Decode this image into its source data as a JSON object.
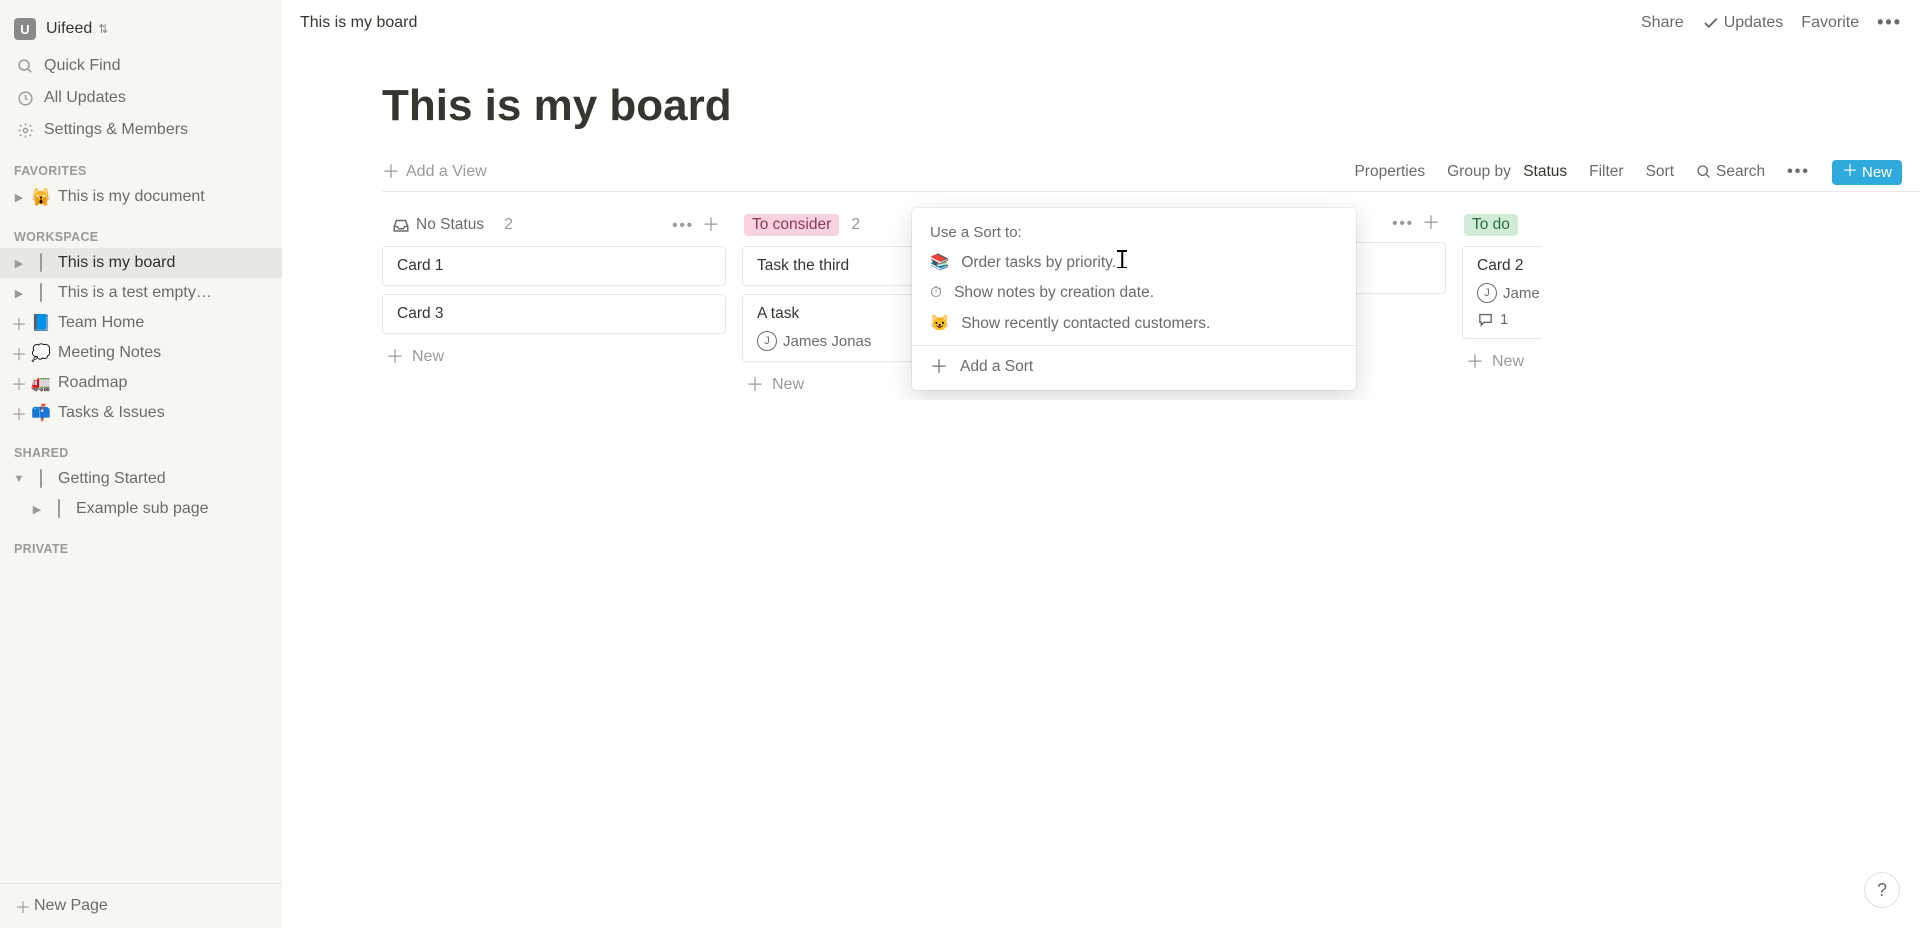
{
  "workspace": {
    "initial": "U",
    "name": "Uifeed"
  },
  "sidebar": {
    "quick_find": "Quick Find",
    "all_updates": "All Updates",
    "settings": "Settings & Members",
    "sections": {
      "favorites": "FAVORITES",
      "workspace": "WORKSPACE",
      "shared": "SHARED",
      "private": "PRIVATE"
    },
    "favorites": [
      {
        "icon": "🙀",
        "label": "This is my document"
      }
    ],
    "workspace_pages": [
      {
        "icon": "page",
        "label": "This is my board",
        "active": true,
        "toggle": "▶"
      },
      {
        "icon": "page",
        "label": "This is a test empty…",
        "toggle": "▶"
      },
      {
        "icon": "📘",
        "label": "Team Home",
        "plus": true
      },
      {
        "icon": "💭",
        "label": "Meeting Notes",
        "plus": true
      },
      {
        "icon": "🚛",
        "label": "Roadmap",
        "plus": true
      },
      {
        "icon": "📫",
        "label": "Tasks & Issues",
        "plus": true
      }
    ],
    "shared_pages": [
      {
        "icon": "page",
        "label": "Getting Started",
        "toggle": "▼"
      },
      {
        "icon": "page",
        "label": "Example sub page",
        "nested": true,
        "toggle": "▶"
      }
    ],
    "new_page": "New Page"
  },
  "topbar": {
    "breadcrumb": "This is my board",
    "share": "Share",
    "updates": "Updates",
    "favorite": "Favorite"
  },
  "page": {
    "title": "This is my board",
    "add_view": "Add a View",
    "toolbar": {
      "properties": "Properties",
      "group_by_label": "Group by",
      "group_by_value": "Status",
      "filter": "Filter",
      "sort": "Sort",
      "search": "Search",
      "new": "New"
    }
  },
  "board": {
    "columns": [
      {
        "id": "no-status",
        "tag_style": "none",
        "name": "No Status",
        "count": "2",
        "show_icon": true,
        "cards": [
          {
            "title": "Card 1"
          },
          {
            "title": "Card 3"
          }
        ]
      },
      {
        "id": "to-consider",
        "tag_style": "pink",
        "name": "To consider",
        "count": "2",
        "cards": [
          {
            "title": "Task the third"
          },
          {
            "title": "A task",
            "assignee_initial": "J",
            "assignee": "James Jonas"
          }
        ]
      },
      {
        "id": "hidden-behind-popup",
        "tag_style": "none",
        "name": "",
        "count": "",
        "cards": [
          {
            "title": ""
          }
        ]
      },
      {
        "id": "to-do",
        "tag_style": "green",
        "name": "To do",
        "count": "",
        "partial": true,
        "cards": [
          {
            "title": "Card 2",
            "assignee_initial": "J",
            "assignee": "Jame",
            "comments": "1"
          }
        ]
      }
    ],
    "new_label": "New"
  },
  "sort_popup": {
    "title": "Use a Sort to:",
    "items": [
      {
        "icon": "📚",
        "label": "Order tasks by priority."
      },
      {
        "icon": "⏱",
        "label": "Show notes by creation date."
      },
      {
        "icon": "😺",
        "label": "Show recently contacted customers."
      }
    ],
    "add": "Add a Sort"
  },
  "help": "?"
}
